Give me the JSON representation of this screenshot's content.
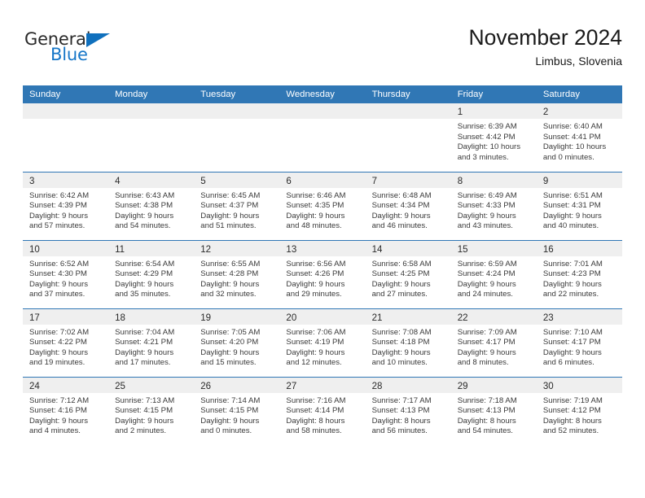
{
  "logo": {
    "word_one": "General",
    "word_two": "Blue",
    "icon": "triangle-flag-icon"
  },
  "header": {
    "month_title": "November 2024",
    "location": "Limbus, Slovenia"
  },
  "calendar": {
    "weekday_headers": [
      "Sunday",
      "Monday",
      "Tuesday",
      "Wednesday",
      "Thursday",
      "Friday",
      "Saturday"
    ],
    "weeks": [
      [
        {
          "day": "",
          "lines": []
        },
        {
          "day": "",
          "lines": []
        },
        {
          "day": "",
          "lines": []
        },
        {
          "day": "",
          "lines": []
        },
        {
          "day": "",
          "lines": []
        },
        {
          "day": "1",
          "lines": [
            "Sunrise: 6:39 AM",
            "Sunset: 4:42 PM",
            "Daylight: 10 hours",
            "and 3 minutes."
          ]
        },
        {
          "day": "2",
          "lines": [
            "Sunrise: 6:40 AM",
            "Sunset: 4:41 PM",
            "Daylight: 10 hours",
            "and 0 minutes."
          ]
        }
      ],
      [
        {
          "day": "3",
          "lines": [
            "Sunrise: 6:42 AM",
            "Sunset: 4:39 PM",
            "Daylight: 9 hours",
            "and 57 minutes."
          ]
        },
        {
          "day": "4",
          "lines": [
            "Sunrise: 6:43 AM",
            "Sunset: 4:38 PM",
            "Daylight: 9 hours",
            "and 54 minutes."
          ]
        },
        {
          "day": "5",
          "lines": [
            "Sunrise: 6:45 AM",
            "Sunset: 4:37 PM",
            "Daylight: 9 hours",
            "and 51 minutes."
          ]
        },
        {
          "day": "6",
          "lines": [
            "Sunrise: 6:46 AM",
            "Sunset: 4:35 PM",
            "Daylight: 9 hours",
            "and 48 minutes."
          ]
        },
        {
          "day": "7",
          "lines": [
            "Sunrise: 6:48 AM",
            "Sunset: 4:34 PM",
            "Daylight: 9 hours",
            "and 46 minutes."
          ]
        },
        {
          "day": "8",
          "lines": [
            "Sunrise: 6:49 AM",
            "Sunset: 4:33 PM",
            "Daylight: 9 hours",
            "and 43 minutes."
          ]
        },
        {
          "day": "9",
          "lines": [
            "Sunrise: 6:51 AM",
            "Sunset: 4:31 PM",
            "Daylight: 9 hours",
            "and 40 minutes."
          ]
        }
      ],
      [
        {
          "day": "10",
          "lines": [
            "Sunrise: 6:52 AM",
            "Sunset: 4:30 PM",
            "Daylight: 9 hours",
            "and 37 minutes."
          ]
        },
        {
          "day": "11",
          "lines": [
            "Sunrise: 6:54 AM",
            "Sunset: 4:29 PM",
            "Daylight: 9 hours",
            "and 35 minutes."
          ]
        },
        {
          "day": "12",
          "lines": [
            "Sunrise: 6:55 AM",
            "Sunset: 4:28 PM",
            "Daylight: 9 hours",
            "and 32 minutes."
          ]
        },
        {
          "day": "13",
          "lines": [
            "Sunrise: 6:56 AM",
            "Sunset: 4:26 PM",
            "Daylight: 9 hours",
            "and 29 minutes."
          ]
        },
        {
          "day": "14",
          "lines": [
            "Sunrise: 6:58 AM",
            "Sunset: 4:25 PM",
            "Daylight: 9 hours",
            "and 27 minutes."
          ]
        },
        {
          "day": "15",
          "lines": [
            "Sunrise: 6:59 AM",
            "Sunset: 4:24 PM",
            "Daylight: 9 hours",
            "and 24 minutes."
          ]
        },
        {
          "day": "16",
          "lines": [
            "Sunrise: 7:01 AM",
            "Sunset: 4:23 PM",
            "Daylight: 9 hours",
            "and 22 minutes."
          ]
        }
      ],
      [
        {
          "day": "17",
          "lines": [
            "Sunrise: 7:02 AM",
            "Sunset: 4:22 PM",
            "Daylight: 9 hours",
            "and 19 minutes."
          ]
        },
        {
          "day": "18",
          "lines": [
            "Sunrise: 7:04 AM",
            "Sunset: 4:21 PM",
            "Daylight: 9 hours",
            "and 17 minutes."
          ]
        },
        {
          "day": "19",
          "lines": [
            "Sunrise: 7:05 AM",
            "Sunset: 4:20 PM",
            "Daylight: 9 hours",
            "and 15 minutes."
          ]
        },
        {
          "day": "20",
          "lines": [
            "Sunrise: 7:06 AM",
            "Sunset: 4:19 PM",
            "Daylight: 9 hours",
            "and 12 minutes."
          ]
        },
        {
          "day": "21",
          "lines": [
            "Sunrise: 7:08 AM",
            "Sunset: 4:18 PM",
            "Daylight: 9 hours",
            "and 10 minutes."
          ]
        },
        {
          "day": "22",
          "lines": [
            "Sunrise: 7:09 AM",
            "Sunset: 4:17 PM",
            "Daylight: 9 hours",
            "and 8 minutes."
          ]
        },
        {
          "day": "23",
          "lines": [
            "Sunrise: 7:10 AM",
            "Sunset: 4:17 PM",
            "Daylight: 9 hours",
            "and 6 minutes."
          ]
        }
      ],
      [
        {
          "day": "24",
          "lines": [
            "Sunrise: 7:12 AM",
            "Sunset: 4:16 PM",
            "Daylight: 9 hours",
            "and 4 minutes."
          ]
        },
        {
          "day": "25",
          "lines": [
            "Sunrise: 7:13 AM",
            "Sunset: 4:15 PM",
            "Daylight: 9 hours",
            "and 2 minutes."
          ]
        },
        {
          "day": "26",
          "lines": [
            "Sunrise: 7:14 AM",
            "Sunset: 4:15 PM",
            "Daylight: 9 hours",
            "and 0 minutes."
          ]
        },
        {
          "day": "27",
          "lines": [
            "Sunrise: 7:16 AM",
            "Sunset: 4:14 PM",
            "Daylight: 8 hours",
            "and 58 minutes."
          ]
        },
        {
          "day": "28",
          "lines": [
            "Sunrise: 7:17 AM",
            "Sunset: 4:13 PM",
            "Daylight: 8 hours",
            "and 56 minutes."
          ]
        },
        {
          "day": "29",
          "lines": [
            "Sunrise: 7:18 AM",
            "Sunset: 4:13 PM",
            "Daylight: 8 hours",
            "and 54 minutes."
          ]
        },
        {
          "day": "30",
          "lines": [
            "Sunrise: 7:19 AM",
            "Sunset: 4:12 PM",
            "Daylight: 8 hours",
            "and 52 minutes."
          ]
        }
      ]
    ]
  },
  "colors": {
    "header_blue": "#3077b5",
    "logo_blue": "#1676c8",
    "daynum_band": "#efefef",
    "text": "#3a3a3a"
  }
}
